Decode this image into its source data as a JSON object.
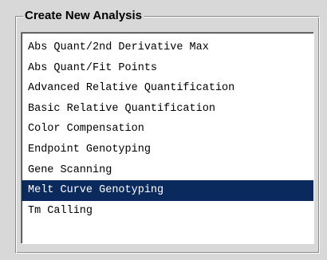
{
  "group": {
    "title": "Create New Analysis"
  },
  "analysis_list": {
    "items": [
      {
        "label": "Abs Quant/2nd Derivative Max",
        "selected": false
      },
      {
        "label": "Abs Quant/Fit Points",
        "selected": false
      },
      {
        "label": "Advanced Relative Quantification",
        "selected": false
      },
      {
        "label": "Basic Relative Quantification",
        "selected": false
      },
      {
        "label": "Color Compensation",
        "selected": false
      },
      {
        "label": "Endpoint Genotyping",
        "selected": false
      },
      {
        "label": "Gene Scanning",
        "selected": false
      },
      {
        "label": "Melt Curve Genotyping",
        "selected": true
      },
      {
        "label": "Tm Calling",
        "selected": false
      }
    ],
    "selected_color": "#0a2a5e"
  }
}
